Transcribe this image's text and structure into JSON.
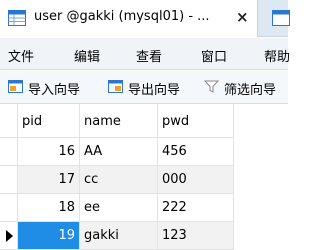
{
  "tab": {
    "title": "user @gakki (mysql01) - ...",
    "close": "×"
  },
  "menu": {
    "items": [
      "文件",
      "编辑",
      "查看",
      "窗口",
      "帮助"
    ]
  },
  "toolbar": {
    "import_label": "导入向导",
    "export_label": "导出向导",
    "filter_label": "筛选向导"
  },
  "table": {
    "columns": [
      "pid",
      "name",
      "pwd"
    ],
    "rows": [
      {
        "pid": "16",
        "name": "AA",
        "pwd": "456"
      },
      {
        "pid": "17",
        "name": "cc",
        "pwd": "000"
      },
      {
        "pid": "18",
        "name": "ee",
        "pwd": "222"
      },
      {
        "pid": "19",
        "name": "gakki",
        "pwd": "123"
      }
    ],
    "selected_row_index": 3
  },
  "colors": {
    "selection": "#1f8ce6",
    "tab_bar": "#dde8f3",
    "alt_row": "#f2f2f2"
  }
}
